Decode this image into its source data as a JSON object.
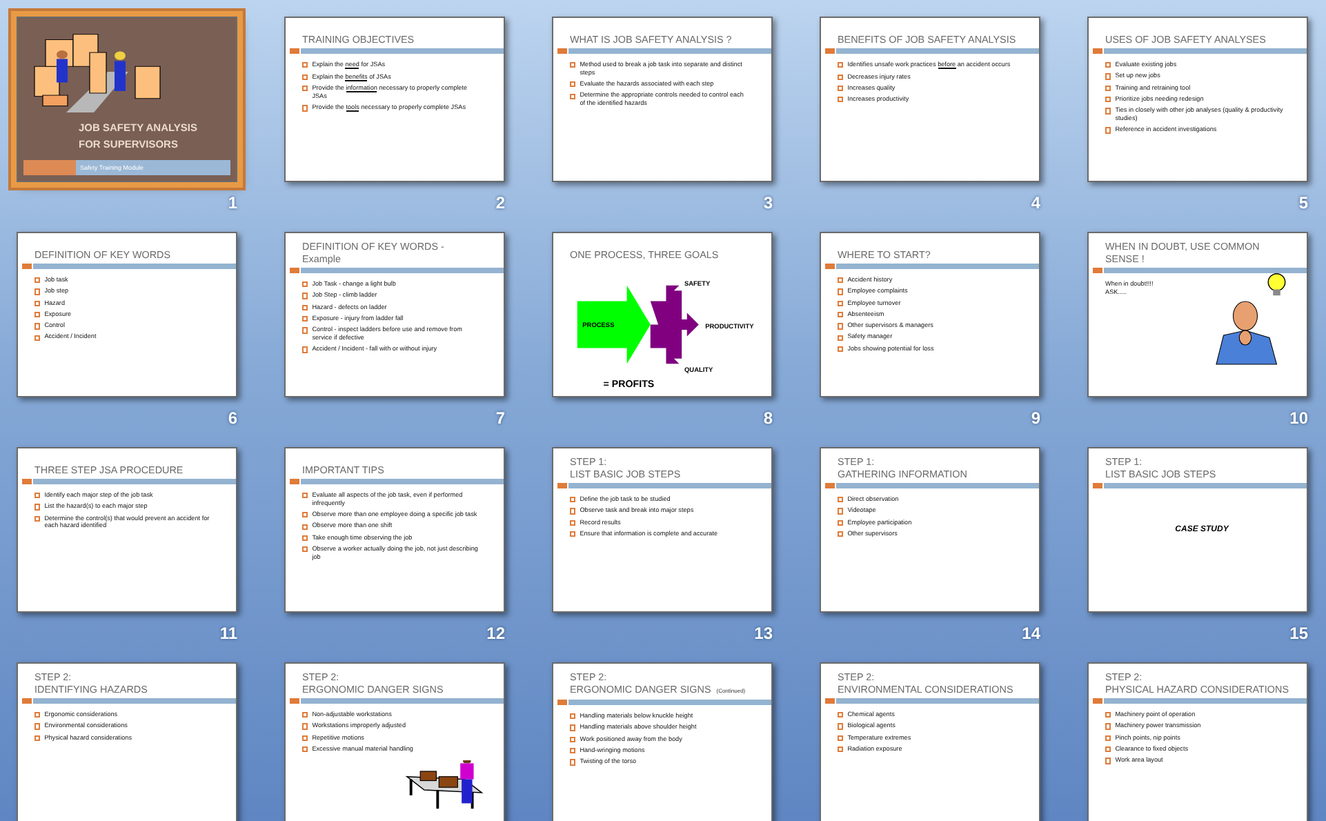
{
  "slides": [
    {
      "kind": "title",
      "selected": true,
      "number": "1",
      "title_lines": [
        "JOB SAFETY ANALYSIS",
        "FOR SUPERVISORS"
      ],
      "subtitle": "Safety Training Module",
      "picture": {
        "kind": "picture"
      }
    },
    {
      "kind": "bullets",
      "selected": false,
      "number": "2",
      "title_lines": [
        "TRAINING OBJECTIVES"
      ],
      "bullets": [
        [
          {
            "text": "Explain the "
          },
          {
            "text": "need",
            "underline": true
          },
          {
            "text": " for JSAs"
          }
        ],
        [
          {
            "text": "Explain the "
          },
          {
            "text": "benefits",
            "underline": true
          },
          {
            "text": " of JSAs"
          }
        ],
        [
          {
            "text": "Provide the "
          },
          {
            "text": "information",
            "underline": true
          },
          {
            "text": " necessary to properly complete JSAs"
          }
        ],
        [
          {
            "text": "Provide the "
          },
          {
            "text": "tools",
            "underline": true
          },
          {
            "text": " necessary to properly complete JSAs"
          }
        ]
      ]
    },
    {
      "kind": "bullets",
      "selected": false,
      "number": "3",
      "title_lines": [
        "WHAT IS JOB SAFETY ANALYSIS ?"
      ],
      "bullets": [
        "Method used to break a job task into separate and distinct steps",
        "Evaluate the hazards associated with each step",
        "Determine the appropriate controls needed to control each of the identified hazards"
      ]
    },
    {
      "kind": "bullets",
      "selected": false,
      "number": "4",
      "title_lines": [
        "BENEFITS OF JOB SAFETY ANALYSIS"
      ],
      "bullets": [
        [
          {
            "text": "Identifies unsafe work practices "
          },
          {
            "text": "before",
            "underline": true
          },
          {
            "text": " an accident occurs"
          }
        ],
        "Decreases injury rates",
        "Increases quality",
        "Increases productivity"
      ]
    },
    {
      "kind": "bullets",
      "selected": false,
      "number": "5",
      "title_lines": [
        "USES OF JOB SAFETY ANALYSES"
      ],
      "bullets": [
        "Evaluate existing jobs",
        "Set up new jobs",
        "Training and retraining tool",
        "Prioritize jobs needing redesign",
        "Ties in closely with other job analyses (quality & productivity studies)",
        "Reference in accident investigations"
      ]
    },
    {
      "kind": "bullets",
      "selected": false,
      "number": "6",
      "title_lines": [
        "DEFINITION OF KEY WORDS"
      ],
      "bullets": [
        "Job task",
        "Job step",
        "Hazard",
        "Exposure",
        "Control",
        "Accident / Incident"
      ]
    },
    {
      "kind": "bullets",
      "selected": false,
      "number": "7",
      "title_lines": [
        "DEFINITION OF KEY WORDS -",
        "Example"
      ],
      "bullets": [
        "Job Task - change a light bulb",
        "Job Step - climb ladder",
        "Hazard - defects on ladder",
        "Exposure - injury from ladder fall",
        "Control - inspect ladders before use and remove from service if defective",
        "Accident / Incident - fall with or without injury"
      ]
    },
    {
      "kind": "diagram",
      "selected": false,
      "number": "8",
      "title_lines": [
        "ONE PROCESS, THREE GOALS"
      ],
      "diagram": {
        "input": "PROCESS",
        "outputs": [
          "SAFETY",
          "PRODUCTIVITY",
          "QUALITY"
        ],
        "result": "= PROFITS"
      }
    },
    {
      "kind": "bullets",
      "selected": false,
      "number": "9",
      "title_lines": [
        "WHERE TO START?"
      ],
      "bullets": [
        "Accident history",
        "Employee complaints",
        "Employee turnover",
        "Absenteeism",
        "Other supervisors & managers",
        "Safety manager",
        "Jobs showing potential for loss"
      ]
    },
    {
      "kind": "text_picture",
      "selected": false,
      "number": "10",
      "title_lines": [
        "WHEN IN DOUBT, USE COMMON",
        "SENSE !"
      ],
      "lines": [
        "When in doubt!!!!",
        "ASK....."
      ],
      "picture": {
        "kind": "picture"
      }
    },
    {
      "kind": "bullets",
      "selected": false,
      "number": "11",
      "title_lines": [
        "THREE STEP JSA PROCEDURE"
      ],
      "bullets": [
        "Identify each major step of the job task",
        "List the hazard(s) to each major step",
        "Determine the control(s) that would prevent an accident for each hazard identified"
      ]
    },
    {
      "kind": "bullets",
      "selected": false,
      "number": "12",
      "title_lines": [
        "IMPORTANT TIPS"
      ],
      "bullets": [
        "Evaluate all aspects of the job task, even if performed infrequently",
        "Observe more than one employee doing a specific job task",
        "Observe more than one shift",
        "Take enough time observing the job",
        "Observe a worker actually doing the job, not just describing job"
      ]
    },
    {
      "kind": "bullets",
      "selected": false,
      "number": "13",
      "title_lines": [
        "STEP 1:",
        "LIST BASIC JOB STEPS"
      ],
      "bullets": [
        "Define the job task to be studied",
        "Observe task and break into major steps",
        "Record results",
        "Ensure that information is complete and accurate"
      ]
    },
    {
      "kind": "bullets",
      "selected": false,
      "number": "14",
      "title_lines": [
        "STEP 1:",
        "GATHERING INFORMATION"
      ],
      "bullets": [
        "Direct observation",
        "Videotape",
        "Employee participation",
        "Other supervisors"
      ]
    },
    {
      "kind": "case_study",
      "selected": false,
      "number": "15",
      "title_lines": [
        "STEP 1:",
        "LIST BASIC JOB STEPS"
      ],
      "caption": "CASE STUDY"
    },
    {
      "kind": "bullets",
      "selected": false,
      "title_lines": [
        "STEP 2:",
        "IDENTIFYING HAZARDS"
      ],
      "bullets": [
        "Ergonomic considerations",
        "Environmental considerations",
        "Physical hazard considerations"
      ]
    },
    {
      "kind": "bullets",
      "selected": false,
      "title_lines": [
        "STEP 2:",
        "ERGONOMIC DANGER SIGNS"
      ],
      "bullets": [
        "Non-adjustable workstations",
        "Workstations improperly adjusted",
        "Repetitive motions",
        "Excessive manual material handling"
      ],
      "picture": {
        "kind": "picture"
      }
    },
    {
      "kind": "bullets",
      "selected": false,
      "title_lines": [
        "STEP 2:",
        "ERGONOMIC DANGER SIGNS"
      ],
      "title_note": "(Continued)",
      "bullets": [
        "Handling materials below knuckle height",
        "Handling materials above shoulder height",
        "Work positioned away from the body",
        "Hand-wringing motions",
        "Twisting of the torso"
      ]
    },
    {
      "kind": "bullets",
      "selected": false,
      "title_lines": [
        "STEP 2:",
        "ENVIRONMENTAL CONSIDERATIONS"
      ],
      "bullets": [
        "Chemical agents",
        "Biological agents",
        "Temperature extremes",
        "Radiation exposure"
      ]
    },
    {
      "kind": "bullets",
      "selected": false,
      "title_lines": [
        "STEP 2:",
        "PHYSICAL HAZARD CONSIDERATIONS"
      ],
      "bullets": [
        "Machinery point of operation",
        "Machinery power transmission",
        "Pinch points, nip points",
        "Clearance to fixed objects",
        "Work area layout"
      ]
    }
  ]
}
